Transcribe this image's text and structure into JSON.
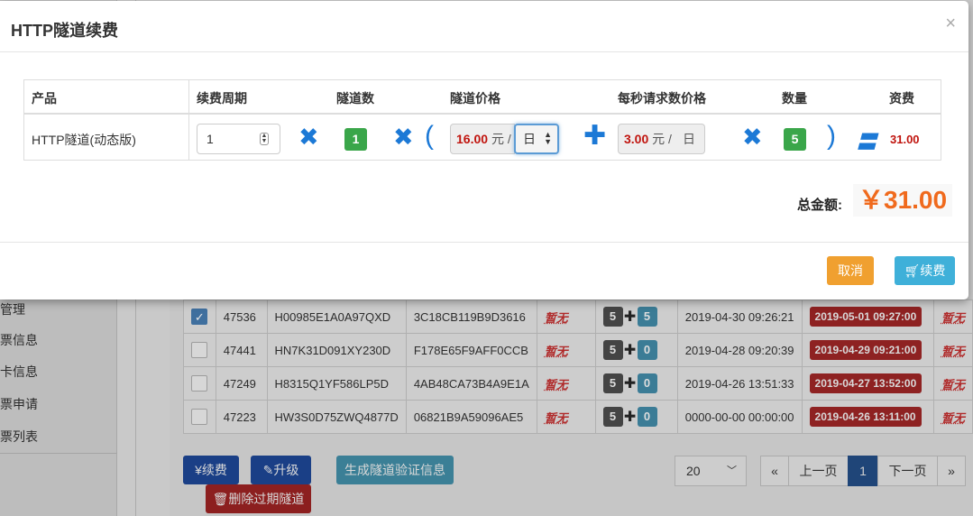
{
  "background": {
    "sidebar_items": [
      "管理",
      "票信息",
      "卡信息",
      "票申请",
      "票列表"
    ],
    "rows": [
      {
        "checked": true,
        "id": "47536",
        "code1": "H00985E1A0A97QXD",
        "code2": "3C18CB119B9D3616",
        "na1": "暂无",
        "n1": "5",
        "n2": "5",
        "created": "2019-04-30 09:26:21",
        "expires": "2019-05-01 09:27:00",
        "na2": "暂无"
      },
      {
        "checked": false,
        "id": "47441",
        "code1": "HN7K31D091XY230D",
        "code2": "F178E65F9AFF0CCB",
        "na1": "暂无",
        "n1": "5",
        "n2": "0",
        "created": "2019-04-28 09:20:39",
        "expires": "2019-04-29 09:21:00",
        "na2": "暂无"
      },
      {
        "checked": false,
        "id": "47249",
        "code1": "H8315Q1YF586LP5D",
        "code2": "4AB48CA73B4A9E1A",
        "na1": "暂无",
        "n1": "5",
        "n2": "0",
        "created": "2019-04-26 13:51:33",
        "expires": "2019-04-27 13:52:00",
        "na2": "暂无"
      },
      {
        "checked": false,
        "id": "47223",
        "code1": "HW3S0D75ZWQ4877D",
        "code2": "06821B9A59096AE5",
        "na1": "暂无",
        "n1": "5",
        "n2": "0",
        "created": "0000-00-00 00:00:00",
        "expires": "2019-04-26 13:11:00",
        "na2": "暂无"
      }
    ],
    "buttons": {
      "renew": "¥续费",
      "upgrade": "升级",
      "gen_verify": "生成隧道验证信息",
      "delete_expired": "删除过期隧道"
    },
    "pager": {
      "page_size": "20",
      "first": "«",
      "prev": "上一页",
      "current": "1",
      "next": "下一页",
      "last": "»"
    }
  },
  "modal": {
    "title": "HTTP隧道续费",
    "close": "×",
    "headers": {
      "product": "产品",
      "period": "续费周期",
      "tunnels": "隧道数",
      "tunnel_price": "隧道价格",
      "rps_price": "每秒请求数价格",
      "quantity": "数量",
      "fee": "资费"
    },
    "row": {
      "product": "HTTP隧道(动态版)",
      "period_value": "1",
      "tunnel_count": "1",
      "tunnel_price": "16.00",
      "unit_yuan": "元 /",
      "period_unit": "日",
      "rps_price": "3.00",
      "rps_unit": "日",
      "quantity": "5",
      "fee": "31.00"
    },
    "symbols": {
      "times": "✖",
      "open_paren": "(",
      "plus": "✚",
      "close_paren": ")",
      "equals": "〓"
    },
    "total_label": "总金额:",
    "total_value": "￥31.00",
    "cancel_label": "取消",
    "renew_label": "续费"
  },
  "colors": {
    "accent": "#1c79d6",
    "price_red": "#c0140e",
    "total_orange": "#f06a1d",
    "badge_green": "#3aa64a",
    "cancel_orange": "#f0a030",
    "renew_blue": "#3fb0d9"
  }
}
